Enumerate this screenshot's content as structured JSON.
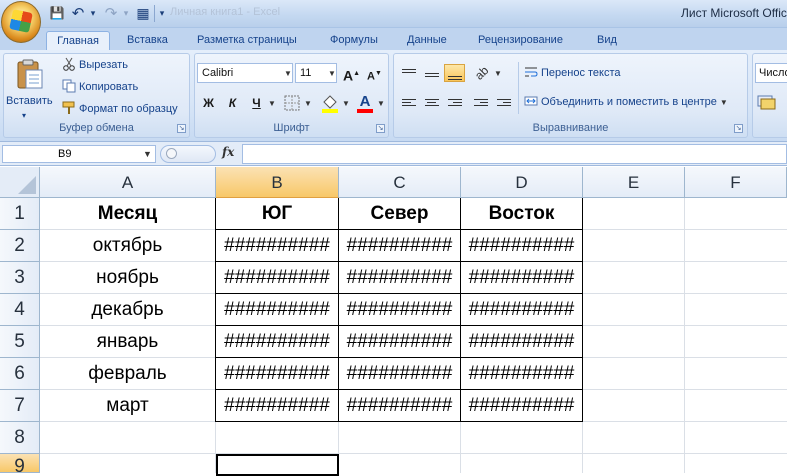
{
  "window": {
    "title_doc": "Личная книга1 - Excel",
    "title_app": "Лист Microsoft Office Excel"
  },
  "qat": {
    "save": "💾",
    "undo": "↶",
    "redo": "↷",
    "grid": "▦",
    "dropdown": "▾"
  },
  "tabs": [
    "Главная",
    "Вставка",
    "Разметка страницы",
    "Формулы",
    "Данные",
    "Рецензирование",
    "Вид"
  ],
  "ribbon": {
    "clipboard": {
      "paste": "Вставить",
      "cut": "Вырезать",
      "copy": "Копировать",
      "format_painter": "Формат по образцу",
      "label": "Буфер обмена"
    },
    "font": {
      "name": "Calibri",
      "size": "11",
      "grow": "A",
      "shrink": "A",
      "bold": "Ж",
      "italic": "К",
      "underline": "Ч",
      "label": "Шрифт",
      "fill_color": "#ffff00",
      "font_color": "#ff0000"
    },
    "alignment": {
      "wrap": "Перенос текста",
      "merge": "Объединить и поместить в центре",
      "label": "Выравнивание"
    },
    "number": {
      "format": "Числовой"
    }
  },
  "formula_bar": {
    "name_box": "B9",
    "fx": "fx",
    "value": ""
  },
  "grid": {
    "columns": [
      "A",
      "B",
      "C",
      "D",
      "E",
      "F"
    ],
    "rows": [
      "1",
      "2",
      "3",
      "4",
      "5",
      "6",
      "7",
      "8",
      "9"
    ],
    "header": [
      "Месяц",
      "ЮГ",
      "Север",
      "Восток"
    ],
    "months": [
      "октябрь",
      "ноябрь",
      "декабрь",
      "январь",
      "февраль",
      "март"
    ],
    "overflow": "##########"
  }
}
